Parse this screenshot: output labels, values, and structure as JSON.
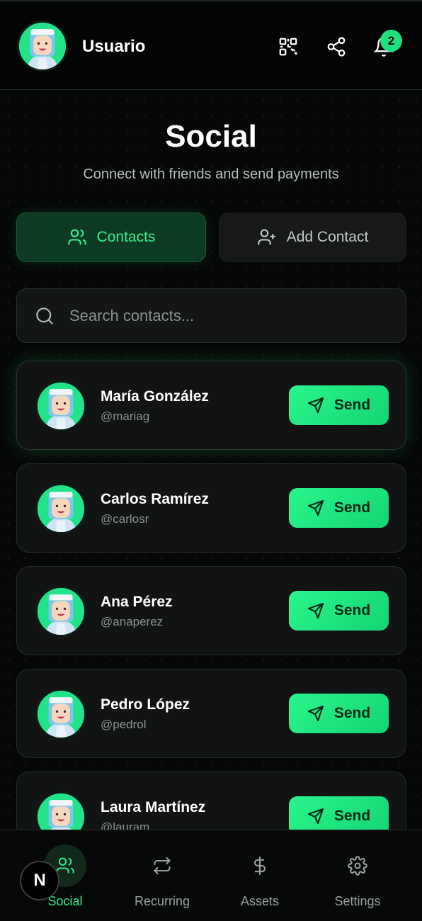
{
  "header": {
    "username": "Usuario",
    "avatar_icon": "user-avatar",
    "icons": [
      "qr-code-icon",
      "share-icon",
      "bell-icon"
    ],
    "notification_count": "2"
  },
  "page": {
    "title": "Social",
    "subtitle": "Connect with friends and send payments"
  },
  "tabs": {
    "contacts_label": "Contacts",
    "add_contact_label": "Add Contact"
  },
  "search": {
    "placeholder": "Search contacts..."
  },
  "contacts": [
    {
      "name": "María González",
      "handle": "@mariag",
      "send_label": "Send"
    },
    {
      "name": "Carlos Ramírez",
      "handle": "@carlosr",
      "send_label": "Send"
    },
    {
      "name": "Ana Pérez",
      "handle": "@anaperez",
      "send_label": "Send"
    },
    {
      "name": "Pedro López",
      "handle": "@pedrol",
      "send_label": "Send"
    },
    {
      "name": "Laura Martínez",
      "handle": "@lauram",
      "send_label": "Send"
    }
  ],
  "nav": {
    "items": [
      {
        "label": "Social",
        "icon": "users-icon",
        "active": true
      },
      {
        "label": "Recurring",
        "icon": "repeat-icon",
        "active": false
      },
      {
        "label": "Assets",
        "icon": "dollar-icon",
        "active": false
      },
      {
        "label": "Settings",
        "icon": "gear-icon",
        "active": false
      }
    ]
  },
  "fab_letter": "N",
  "colors": {
    "accent": "#22e38a",
    "background": "#060707",
    "card": "#111413"
  }
}
